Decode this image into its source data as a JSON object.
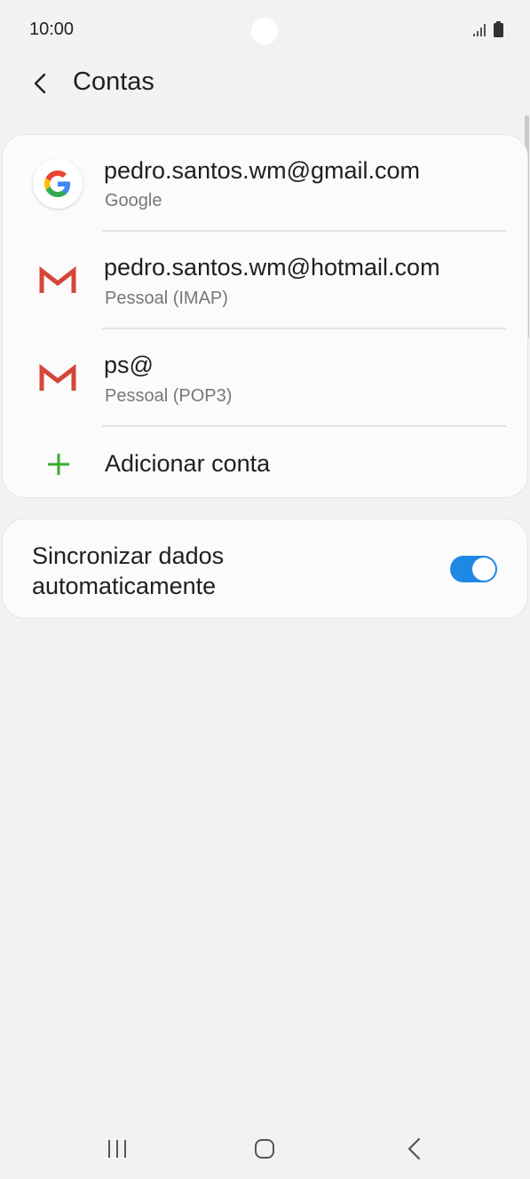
{
  "status_bar": {
    "time": "10:00"
  },
  "header": {
    "title": "Contas"
  },
  "accounts": [
    {
      "email": "pedro.santos.wm@gmail.com",
      "type": "Google",
      "icon": "google-icon"
    },
    {
      "email": "pedro.santos.wm@hotmail.com",
      "type": "Pessoal (IMAP)",
      "icon": "gmail-icon"
    },
    {
      "email": "ps@",
      "type": "Pessoal (POP3)",
      "icon": "gmail-icon"
    }
  ],
  "add_account": {
    "label": "Adicionar conta",
    "icon": "plus-icon"
  },
  "sync": {
    "label_line1": "Sincronizar dados",
    "label_line2": "automaticamente",
    "enabled": true
  },
  "colors": {
    "accent": "#1e88e5",
    "add_green": "#3aab2f",
    "gmail_red": "#d44638"
  }
}
